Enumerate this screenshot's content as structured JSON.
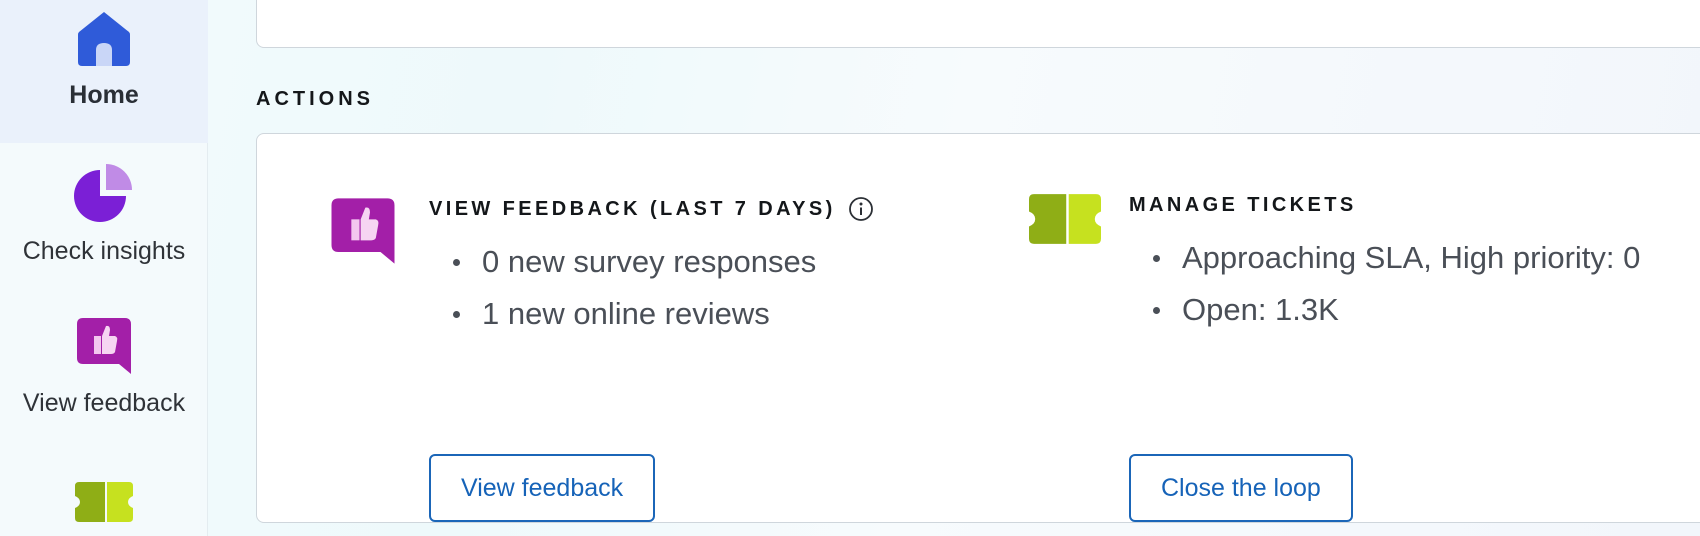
{
  "sidebar": {
    "items": [
      {
        "label": "Home",
        "icon": "home-icon",
        "active": true
      },
      {
        "label": "Check insights",
        "icon": "pie-chart-icon"
      },
      {
        "label": "View feedback",
        "icon": "thumbs-up-icon"
      },
      {
        "label": "",
        "icon": "ticket-icon"
      }
    ]
  },
  "actions": {
    "title": "ACTIONS",
    "feedback": {
      "heading": "VIEW FEEDBACK (LAST 7 DAYS)",
      "bullets": [
        "0 new survey responses",
        "1 new online reviews"
      ],
      "button": "View feedback"
    },
    "tickets": {
      "heading": "MANAGE TICKETS",
      "bullets": [
        "Approaching SLA, High priority: 0",
        "Open: 1.3K"
      ],
      "button": "Close the loop"
    }
  },
  "colors": {
    "home_icon": "#2f5bd9",
    "insights_icon": "#7b1fd6",
    "feedback_icon": "#a31fa8",
    "ticket_icon_dark": "#8fae16",
    "ticket_icon_light": "#c6e11f",
    "button_text": "#1663b8"
  }
}
